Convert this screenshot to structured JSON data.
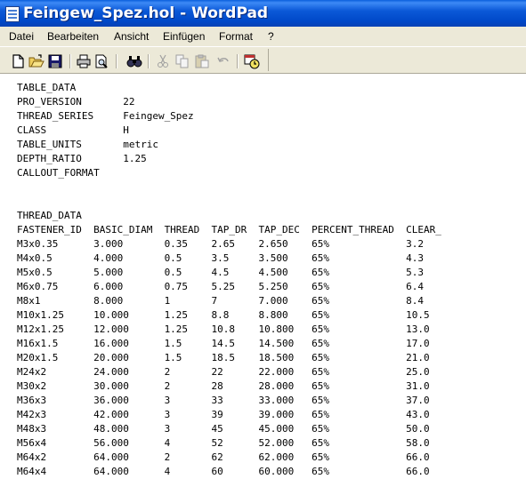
{
  "window": {
    "title": "Feingew_Spez.hol - WordPad"
  },
  "menu": [
    "Datei",
    "Bearbeiten",
    "Ansicht",
    "Einfügen",
    "Format",
    "?"
  ],
  "toolbar": {
    "buttons": [
      "new-document-icon",
      "open-folder-icon",
      "save-icon",
      "print-icon",
      "print-preview-icon",
      "find-icon",
      "cut-icon",
      "copy-icon",
      "paste-icon",
      "undo-icon",
      "insert-date-time-icon"
    ]
  },
  "document": {
    "lines": [
      "TABLE_DATA",
      "PRO_VERSION       22",
      "THREAD_SERIES     Feingew_Spez",
      "CLASS             H",
      "TABLE_UNITS       metric",
      "DEPTH_RATIO       1.25",
      "CALLOUT_FORMAT",
      "",
      "",
      "THREAD_DATA",
      "FASTENER_ID  BASIC_DIAM  THREAD  TAP_DR  TAP_DEC  PERCENT_THREAD  CLEAR_",
      "M3x0.35      3.000       0.35    2.65    2.650    65%             3.2",
      "M4x0.5       4.000       0.5     3.5     3.500    65%             4.3",
      "M5x0.5       5.000       0.5     4.5     4.500    65%             5.3",
      "M6x0.75      6.000       0.75    5.25    5.250    65%             6.4",
      "M8x1         8.000       1       7       7.000    65%             8.4",
      "M10x1.25     10.000      1.25    8.8     8.800    65%             10.5",
      "M12x1.25     12.000      1.25    10.8    10.800   65%             13.0",
      "M16x1.5      16.000      1.5     14.5    14.500   65%             17.0",
      "M20x1.5      20.000      1.5     18.5    18.500   65%             21.0",
      "M24x2        24.000      2       22      22.000   65%             25.0",
      "M30x2        30.000      2       28      28.000   65%             31.0",
      "M36x3        36.000      3       33      33.000   65%             37.0",
      "M42x3        42.000      3       39      39.000   65%             43.0",
      "M48x3        48.000      3       45      45.000   65%             50.0",
      "M56x4        56.000      4       52      52.000   65%             58.0",
      "M64x2        64.000      2       62      62.000   65%             66.0",
      "M64x4        64.000      4       60      60.000   65%             66.0"
    ]
  }
}
